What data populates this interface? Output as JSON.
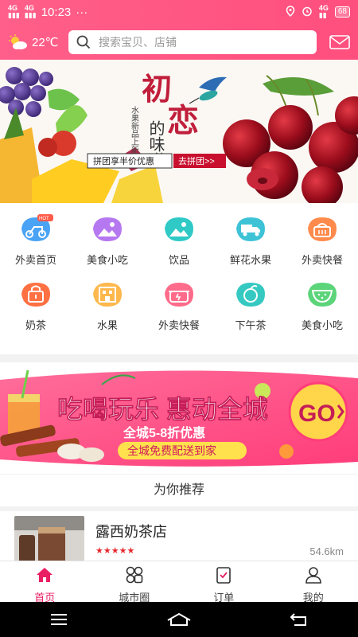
{
  "status_bar": {
    "network1": "4G",
    "network2": "4G",
    "time": "10:23",
    "dots": "···",
    "net_right": "4G",
    "battery": "68"
  },
  "header": {
    "temperature": "22℃",
    "search_placeholder": "搜索宝贝、店铺"
  },
  "banner": {
    "big1": "初",
    "big2": "恋",
    "vertical": "水果新品上新季",
    "middle": "的味道",
    "promo": "拼团享半价优惠",
    "cta": "去拼团>>"
  },
  "categories": [
    {
      "label": "外卖首页",
      "badge": "HOT",
      "icon": "scooter-icon",
      "color": "#4aa3f5"
    },
    {
      "label": "美食小吃",
      "icon": "picture-icon",
      "color": "#b678f0"
    },
    {
      "label": "饮品",
      "icon": "picture-icon",
      "color": "#2fc9c6"
    },
    {
      "label": "鲜花水果",
      "icon": "truck-icon",
      "color": "#3ec3d6"
    },
    {
      "label": "外卖快餐",
      "icon": "basket-icon",
      "color": "#ff8a4c"
    },
    {
      "label": "奶茶",
      "icon": "lock-icon",
      "color": "#ff7043"
    },
    {
      "label": "水果",
      "icon": "building-icon",
      "color": "#ffb84d"
    },
    {
      "label": "外卖快餐",
      "icon": "pot-icon",
      "color": "#ff6b8a"
    },
    {
      "label": "下午茶",
      "icon": "orange-icon",
      "color": "#35c9c2"
    },
    {
      "label": "美食小吃",
      "icon": "watermelon-icon",
      "color": "#5bd47a"
    }
  ],
  "promo": {
    "headline": "吃喝玩乐  惠动全城",
    "sub": "全城5-8折优惠",
    "ribbon": "全城免费配送到家",
    "go": "GO"
  },
  "recommend": {
    "title": "为你推荐"
  },
  "shop": {
    "name": "露西奶茶店",
    "stars": "★★★★★",
    "distance": "54.6km"
  },
  "tabs": [
    {
      "label": "首页",
      "icon": "home-icon",
      "active": true
    },
    {
      "label": "城市圈",
      "icon": "grid-icon",
      "active": false
    },
    {
      "label": "订单",
      "icon": "clipboard-icon",
      "active": false
    },
    {
      "label": "我的",
      "icon": "user-icon",
      "active": false
    }
  ],
  "colors": {
    "accent": "#ff5f8a",
    "active_tab": "#e91e63"
  }
}
